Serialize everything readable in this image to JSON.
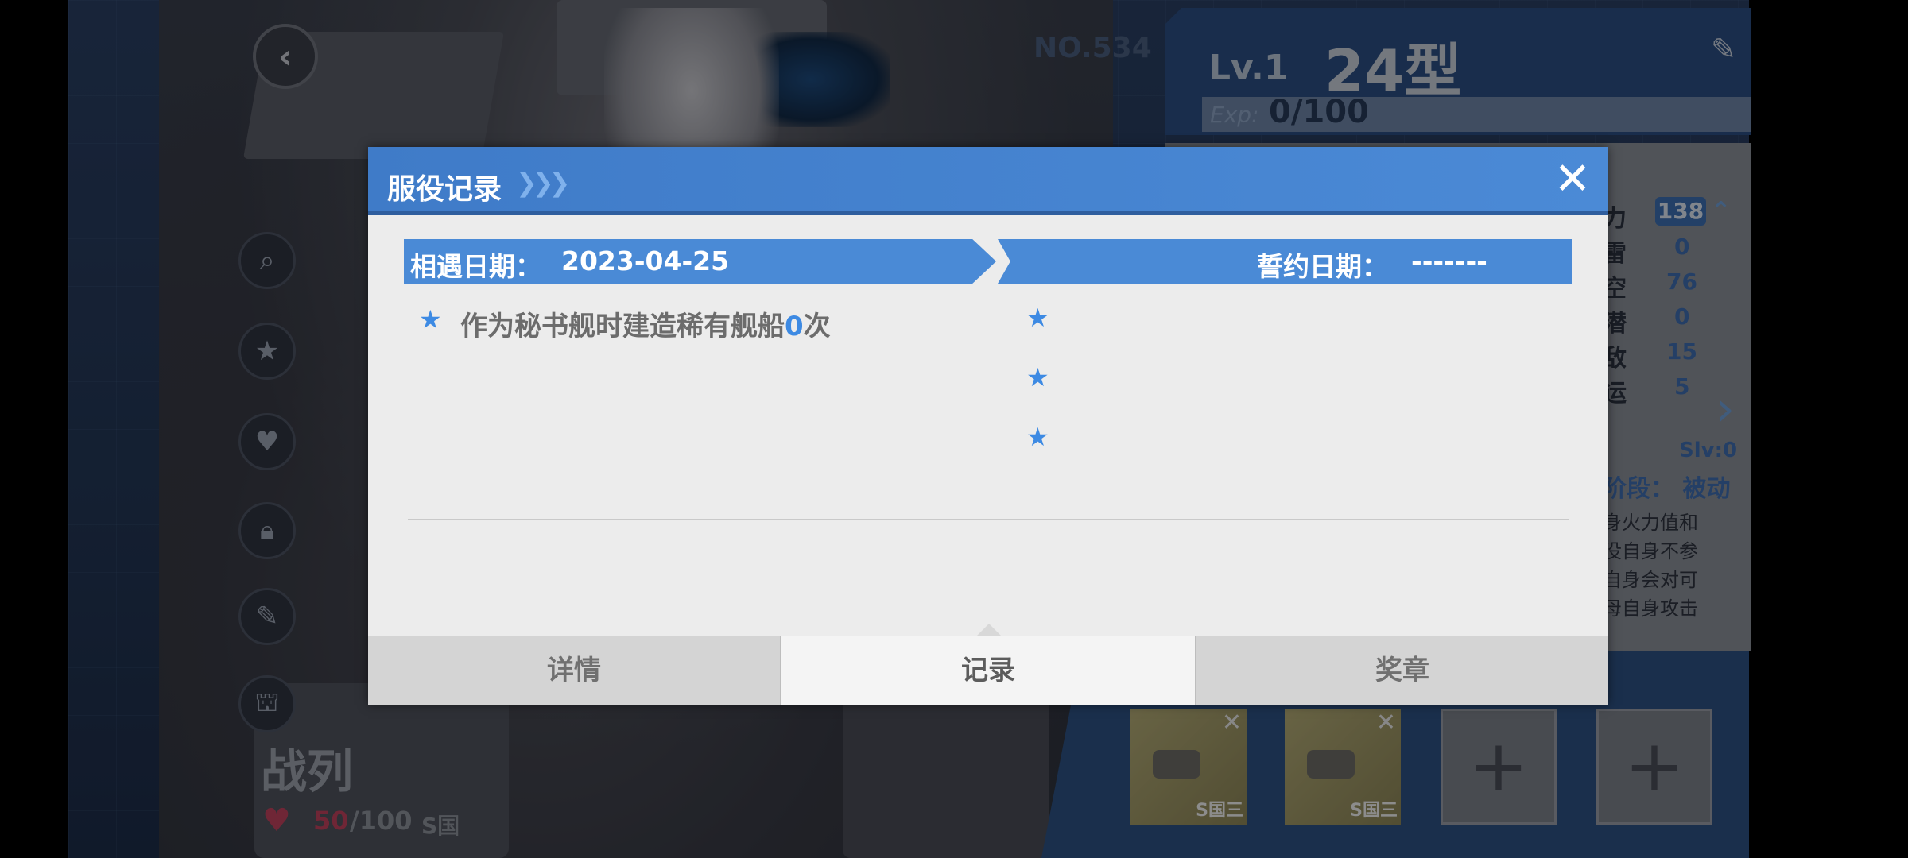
{
  "background": {
    "ship_no": "NO.534",
    "level_label": "Lv.1",
    "ship_name": "24型",
    "exp_label": "Exp:",
    "exp_value": "0/100",
    "stats": [
      {
        "name": "力",
        "value": "138"
      },
      {
        "name": "雷",
        "value": "0"
      },
      {
        "name": "空",
        "value": "76"
      },
      {
        "name": "潜",
        "value": "0"
      },
      {
        "name": "敌",
        "value": "15"
      },
      {
        "name": "运",
        "value": "5"
      }
    ],
    "slv": "Slv:0",
    "skill_stage": "阶段：  被动",
    "skill_desc": [
      "身火力值和",
      "没自身不参",
      "自身会对可",
      "母自身攻击"
    ],
    "ship_class": "战列",
    "mood_value": "50",
    "mood_max": "/100",
    "nation": "S国",
    "equipment": [
      {
        "label": "S国三"
      },
      {
        "label": "S国三"
      }
    ]
  },
  "modal": {
    "title": "服役记录",
    "close_icon": "close-icon",
    "meet_date_label": "相遇日期：",
    "meet_date_value": "2023-04-25",
    "oath_date_label": "誓约日期：",
    "oath_date_value": "-------",
    "records_left": [
      {
        "prefix": "作为秘书舰时建造稀有舰船",
        "count": "0",
        "suffix": "次"
      }
    ],
    "tabs": [
      {
        "label": "详情",
        "active": false
      },
      {
        "label": "记录",
        "active": true
      },
      {
        "label": "奖章",
        "active": false
      }
    ]
  },
  "colors": {
    "accent_blue": "#4a8ad6",
    "header_blue": "#3f7bc8",
    "count_blue": "#3d8ae3",
    "mood_pink": "#c0425e"
  }
}
